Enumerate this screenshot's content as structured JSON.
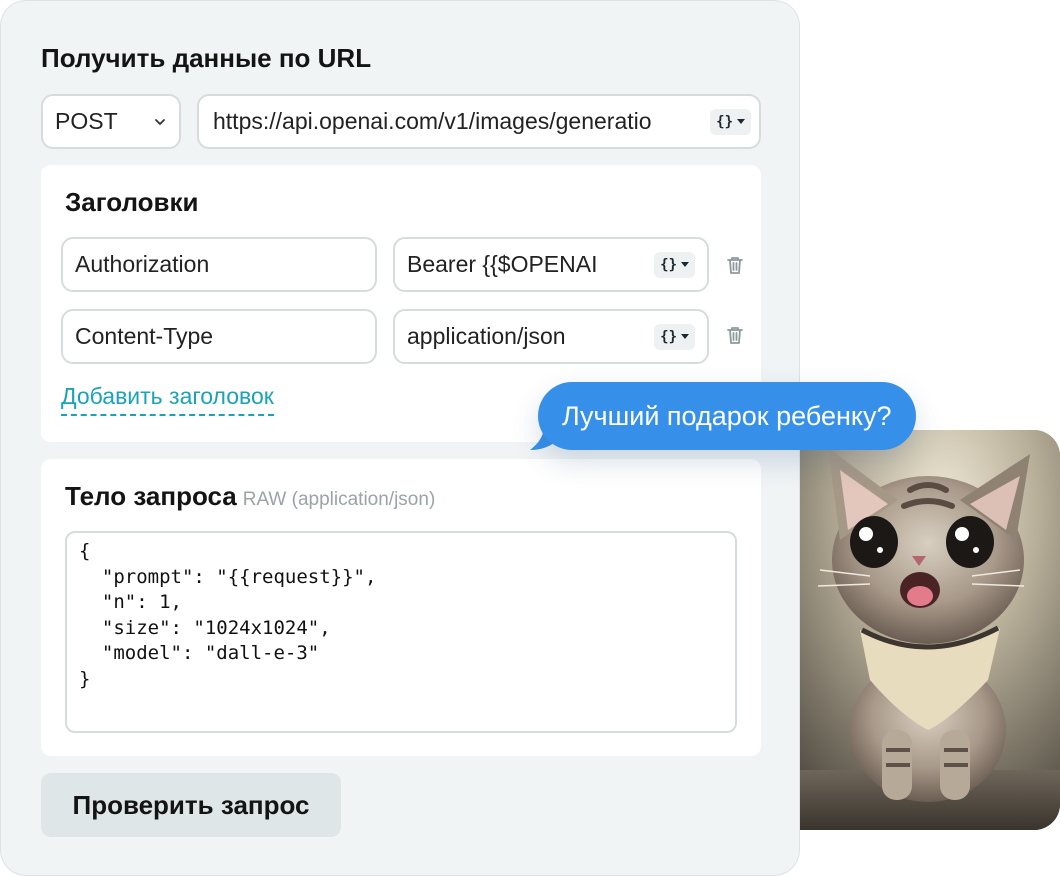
{
  "form": {
    "title": "Получить данные по URL",
    "method": {
      "selected": "POST"
    },
    "url": {
      "value": "https://api.openai.com/v1/images/generatio"
    },
    "variable_button": "{}"
  },
  "headers": {
    "title": "Заголовки",
    "rows": [
      {
        "key": "Authorization",
        "value": "Bearer {{$OPENAI"
      },
      {
        "key": "Content-Type",
        "value": "application/json"
      }
    ],
    "add_label": "Добавить заголовок"
  },
  "body": {
    "title": "Тело запроса",
    "subtitle": "RAW (application/json)",
    "code": "{\n  \"prompt\": \"{{request}}\",\n  \"n\": 1,\n  \"size\": \"1024x1024\",\n  \"model\": \"dall-e-3\"\n}"
  },
  "actions": {
    "check_label": "Проверить запрос"
  },
  "chat": {
    "bubble_text": "Лучший подарок ребенку?"
  },
  "colors": {
    "accent_link": "#1aa3b8",
    "bubble": "#3690ea",
    "card_bg": "#f0f4f5"
  },
  "icons": [
    "chevron-down-icon",
    "variable-icon",
    "trash-icon"
  ]
}
